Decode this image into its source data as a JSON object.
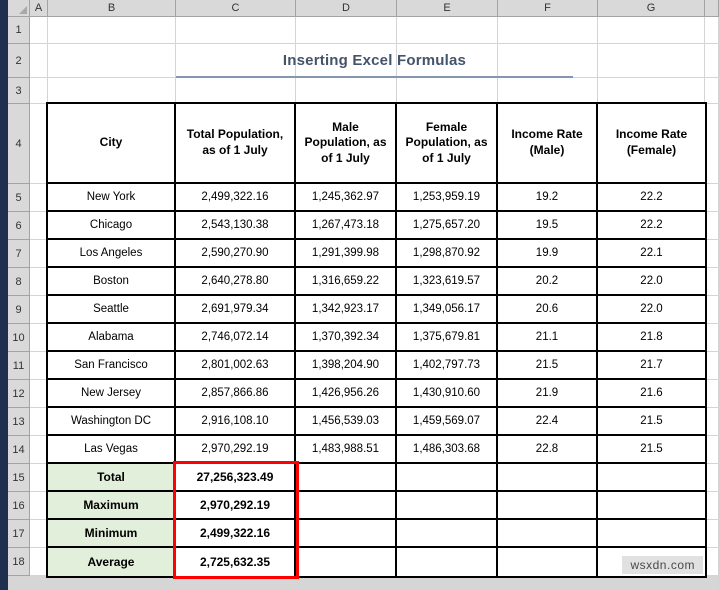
{
  "window": {
    "watermark": "wsxdn.com"
  },
  "sheet": {
    "title": "Inserting Excel Formulas",
    "column_headers": [
      "A",
      "B",
      "C",
      "D",
      "E",
      "F",
      "G"
    ],
    "row_headers": [
      "1",
      "2",
      "3",
      "4",
      "5",
      "6",
      "7",
      "8",
      "9",
      "10",
      "11",
      "12",
      "13",
      "14",
      "15",
      "16",
      "17",
      "18"
    ]
  },
  "table": {
    "headers": [
      "City",
      "Total Population, as of 1 July",
      "Male Population, as of 1 July",
      "Female Population, as of 1 July",
      "Income Rate (Male)",
      "Income Rate (Female)"
    ],
    "rows": [
      [
        "New York",
        "2,499,322.16",
        "1,245,362.97",
        "1,253,959.19",
        "19.2",
        "22.2"
      ],
      [
        "Chicago",
        "2,543,130.38",
        "1,267,473.18",
        "1,275,657.20",
        "19.5",
        "22.2"
      ],
      [
        "Los Angeles",
        "2,590,270.90",
        "1,291,399.98",
        "1,298,870.92",
        "19.9",
        "22.1"
      ],
      [
        "Boston",
        "2,640,278.80",
        "1,316,659.22",
        "1,323,619.57",
        "20.2",
        "22.0"
      ],
      [
        "Seattle",
        "2,691,979.34",
        "1,342,923.17",
        "1,349,056.17",
        "20.6",
        "22.0"
      ],
      [
        "Alabama",
        "2,746,072.14",
        "1,370,392.34",
        "1,375,679.81",
        "21.1",
        "21.8"
      ],
      [
        "San Francisco",
        "2,801,002.63",
        "1,398,204.90",
        "1,402,797.73",
        "21.5",
        "21.7"
      ],
      [
        "New Jersey",
        "2,857,866.86",
        "1,426,956.26",
        "1,430,910.60",
        "21.9",
        "21.6"
      ],
      [
        "Washington DC",
        "2,916,108.10",
        "1,456,539.03",
        "1,459,569.07",
        "22.4",
        "21.5"
      ],
      [
        "Las Vegas",
        "2,970,292.19",
        "1,483,988.51",
        "1,486,303.68",
        "22.8",
        "21.5"
      ]
    ],
    "summary": [
      {
        "label": "Total",
        "value": "27,256,323.49"
      },
      {
        "label": "Maximum",
        "value": "2,970,292.19"
      },
      {
        "label": "Minimum",
        "value": "2,499,322.16"
      },
      {
        "label": "Average",
        "value": "2,725,632.35"
      }
    ]
  },
  "colors": {
    "title_text": "#44546A",
    "title_underline": "#8496B0",
    "summary_label_bg": "#E2EFDA",
    "highlight_border": "#FF0000",
    "header_bg": "#D9D9D9",
    "gridline": "#D4D4D4",
    "table_border": "#000000",
    "window_edge": "#1E2F50"
  }
}
